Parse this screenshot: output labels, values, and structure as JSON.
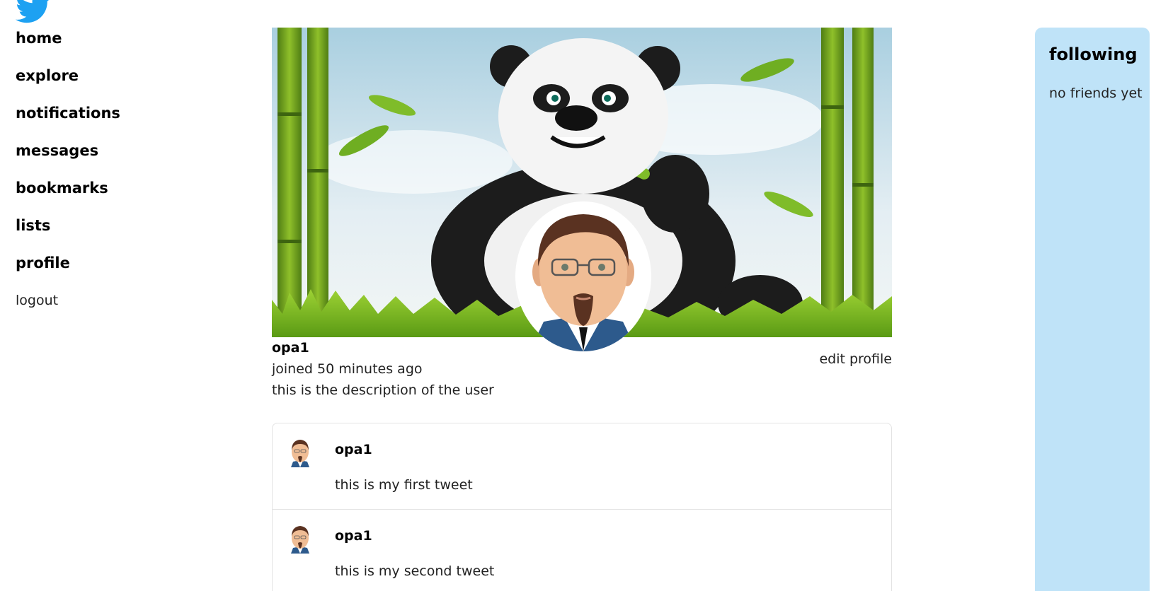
{
  "brand": {
    "logo_icon": "twitter-bird-icon",
    "color": "#1da1f2"
  },
  "nav": {
    "items": [
      {
        "label": "home"
      },
      {
        "label": "explore"
      },
      {
        "label": "notifications"
      },
      {
        "label": "messages"
      },
      {
        "label": "bookmarks"
      },
      {
        "label": "lists"
      },
      {
        "label": "profile"
      },
      {
        "label": "logout"
      }
    ]
  },
  "profile": {
    "banner_icon": "panda-banner-image",
    "avatar_icon": "user-avatar-image",
    "username": "opa1",
    "joined": "joined 50 minutes ago",
    "description": "this is the description of the user",
    "edit_label": "edit profile"
  },
  "tweets": [
    {
      "user": "opa1",
      "text": "this is my first tweet"
    },
    {
      "user": "opa1",
      "text": "this is my second tweet"
    }
  ],
  "following": {
    "title": "following",
    "empty_text": "no friends yet",
    "panel_color": "#bfe3f8"
  }
}
